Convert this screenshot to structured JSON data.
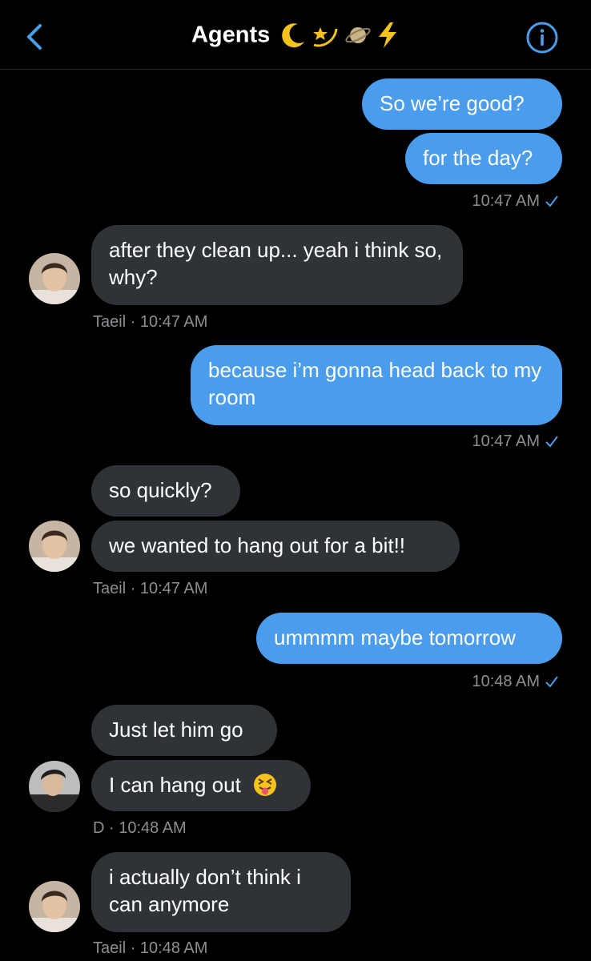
{
  "header": {
    "title": "Agents",
    "emoji_icons": [
      "crescent-moon-icon",
      "dizzy-star-icon",
      "ringed-planet-icon",
      "lightning-icon"
    ]
  },
  "colors": {
    "background": "#000000",
    "outgoing_bubble": "#4a9ded",
    "incoming_bubble": "#2f3337",
    "accent": "#4a9ded",
    "meta_text": "#8b8f94"
  },
  "messages": [
    {
      "dir": "out",
      "text": "So we’re good?"
    },
    {
      "dir": "out",
      "text": "for the day?",
      "meta": "10:47 AM"
    },
    {
      "dir": "in",
      "text": "after they clean up... yeah i think so, why?",
      "meta": "Taeil · 10:47 AM"
    },
    {
      "dir": "out",
      "text": "because i’m gonna head back to my room",
      "meta": "10:47 AM"
    },
    {
      "dir": "in",
      "text": "so quickly?"
    },
    {
      "dir": "in",
      "text": "we wanted to hang out for a bit!!",
      "meta": "Taeil · 10:47 AM"
    },
    {
      "dir": "out",
      "text": "ummmm maybe tomorrow",
      "meta": "10:48 AM"
    },
    {
      "dir": "in",
      "text": "Just let him go"
    },
    {
      "dir": "in",
      "text": "I can hang out",
      "emoji": "squinting-tongue-face-icon",
      "meta": "D · 10:48 AM"
    },
    {
      "dir": "in",
      "text": "i actually don’t think i can anymore",
      "meta": "Taeil · 10:48 AM"
    }
  ]
}
